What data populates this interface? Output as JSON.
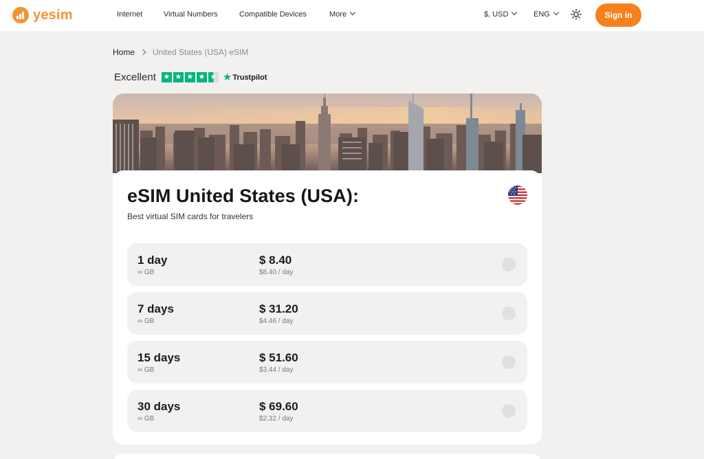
{
  "header": {
    "logo_text": "yesim",
    "nav": [
      {
        "label": "Internet"
      },
      {
        "label": "Virtual Numbers"
      },
      {
        "label": "Compatible Devices"
      },
      {
        "label": "More"
      }
    ],
    "currency": "$, USD",
    "language": "ENG",
    "theme_icon": "sun-icon",
    "signin_label": "Sign in",
    "accent_color": "#f5821f"
  },
  "breadcrumb": {
    "home": "Home",
    "current": "United States (USA) eSIM"
  },
  "trustpilot": {
    "label": "Excellent",
    "stars": 4.5,
    "brand": "Trustpilot"
  },
  "card": {
    "hero_image": "new-york-skyline-photo",
    "title": "eSIM United States (USA):",
    "subtitle": "Best virtual SIM cards for travelers",
    "flag": "us-flag-icon",
    "plans": [
      {
        "days": "1 day",
        "gb": "∞ GB",
        "price": "$ 8.40",
        "per_day": "$8.40 / day"
      },
      {
        "days": "7 days",
        "gb": "∞ GB",
        "price": "$ 31.20",
        "per_day": "$4.46 / day"
      },
      {
        "days": "15 days",
        "gb": "∞ GB",
        "price": "$ 51.60",
        "per_day": "$3.44 / day"
      },
      {
        "days": "30 days",
        "gb": "∞ GB",
        "price": "$ 69.60",
        "per_day": "$2.32 / day"
      }
    ]
  }
}
